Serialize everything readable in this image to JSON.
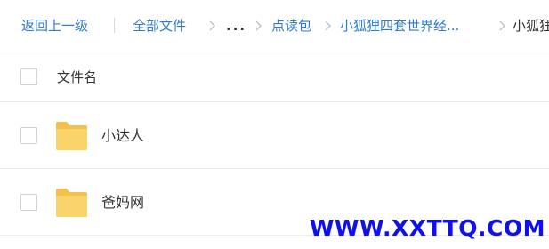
{
  "breadcrumb": {
    "back_label": "返回上一级",
    "all_files_label": "全部文件",
    "ellipsis_label": "...",
    "dianduobao_label": "点读包",
    "series_label": "小狐狸四套世界经...",
    "current_label": "小狐狸"
  },
  "list_header": {
    "name_column": "文件名"
  },
  "files": [
    {
      "name": "小达人",
      "icon": "folder-icon"
    },
    {
      "name": "爸妈网",
      "icon": "folder-icon"
    }
  ],
  "watermark": "WWW.XXTTQ.COM",
  "colors": {
    "link": "#2f7ad3",
    "folder": "#f9ce5a",
    "watermark": "#1010ee"
  }
}
